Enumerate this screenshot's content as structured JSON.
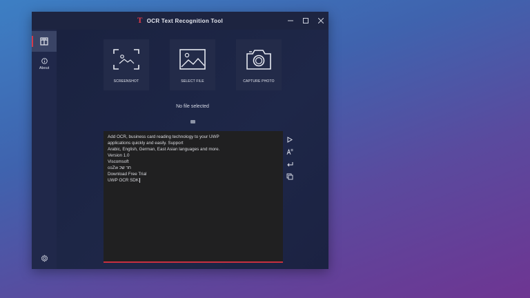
{
  "window": {
    "title": "OCR Text Recognition Tool",
    "logo": "T",
    "controls": [
      "minimize-icon",
      "maximize-icon",
      "close-icon"
    ]
  },
  "sidebar": {
    "items": [
      {
        "name": "home",
        "icon": "document-icon",
        "label": ""
      },
      {
        "name": "about",
        "icon": "info-icon",
        "label": "About"
      }
    ],
    "settings_icon": "gear-icon"
  },
  "actions": {
    "screenshot": "SCREENSHOT",
    "select_file": "SELECT FILE",
    "capture_photo": "CAPTURE PHOTO"
  },
  "status": "No file selected",
  "result_text": {
    "lines": [
      "Add OCR, business card reading technology to your UWP",
      "applications quickly and easily. Support",
      "Arabic, English, German, East Asian languages and more.",
      "Version 1.0",
      "Viscomsoft",
      "coZw חר שכ",
      "Download Free Trial",
      "UWP OCR SDK"
    ]
  },
  "tools": [
    "play-icon",
    "translate-icon",
    "enter-icon",
    "copy-icon"
  ],
  "colors": {
    "accent": "#d43a4a",
    "window_bg": "#1c2340",
    "textbox_bg": "#202021"
  }
}
